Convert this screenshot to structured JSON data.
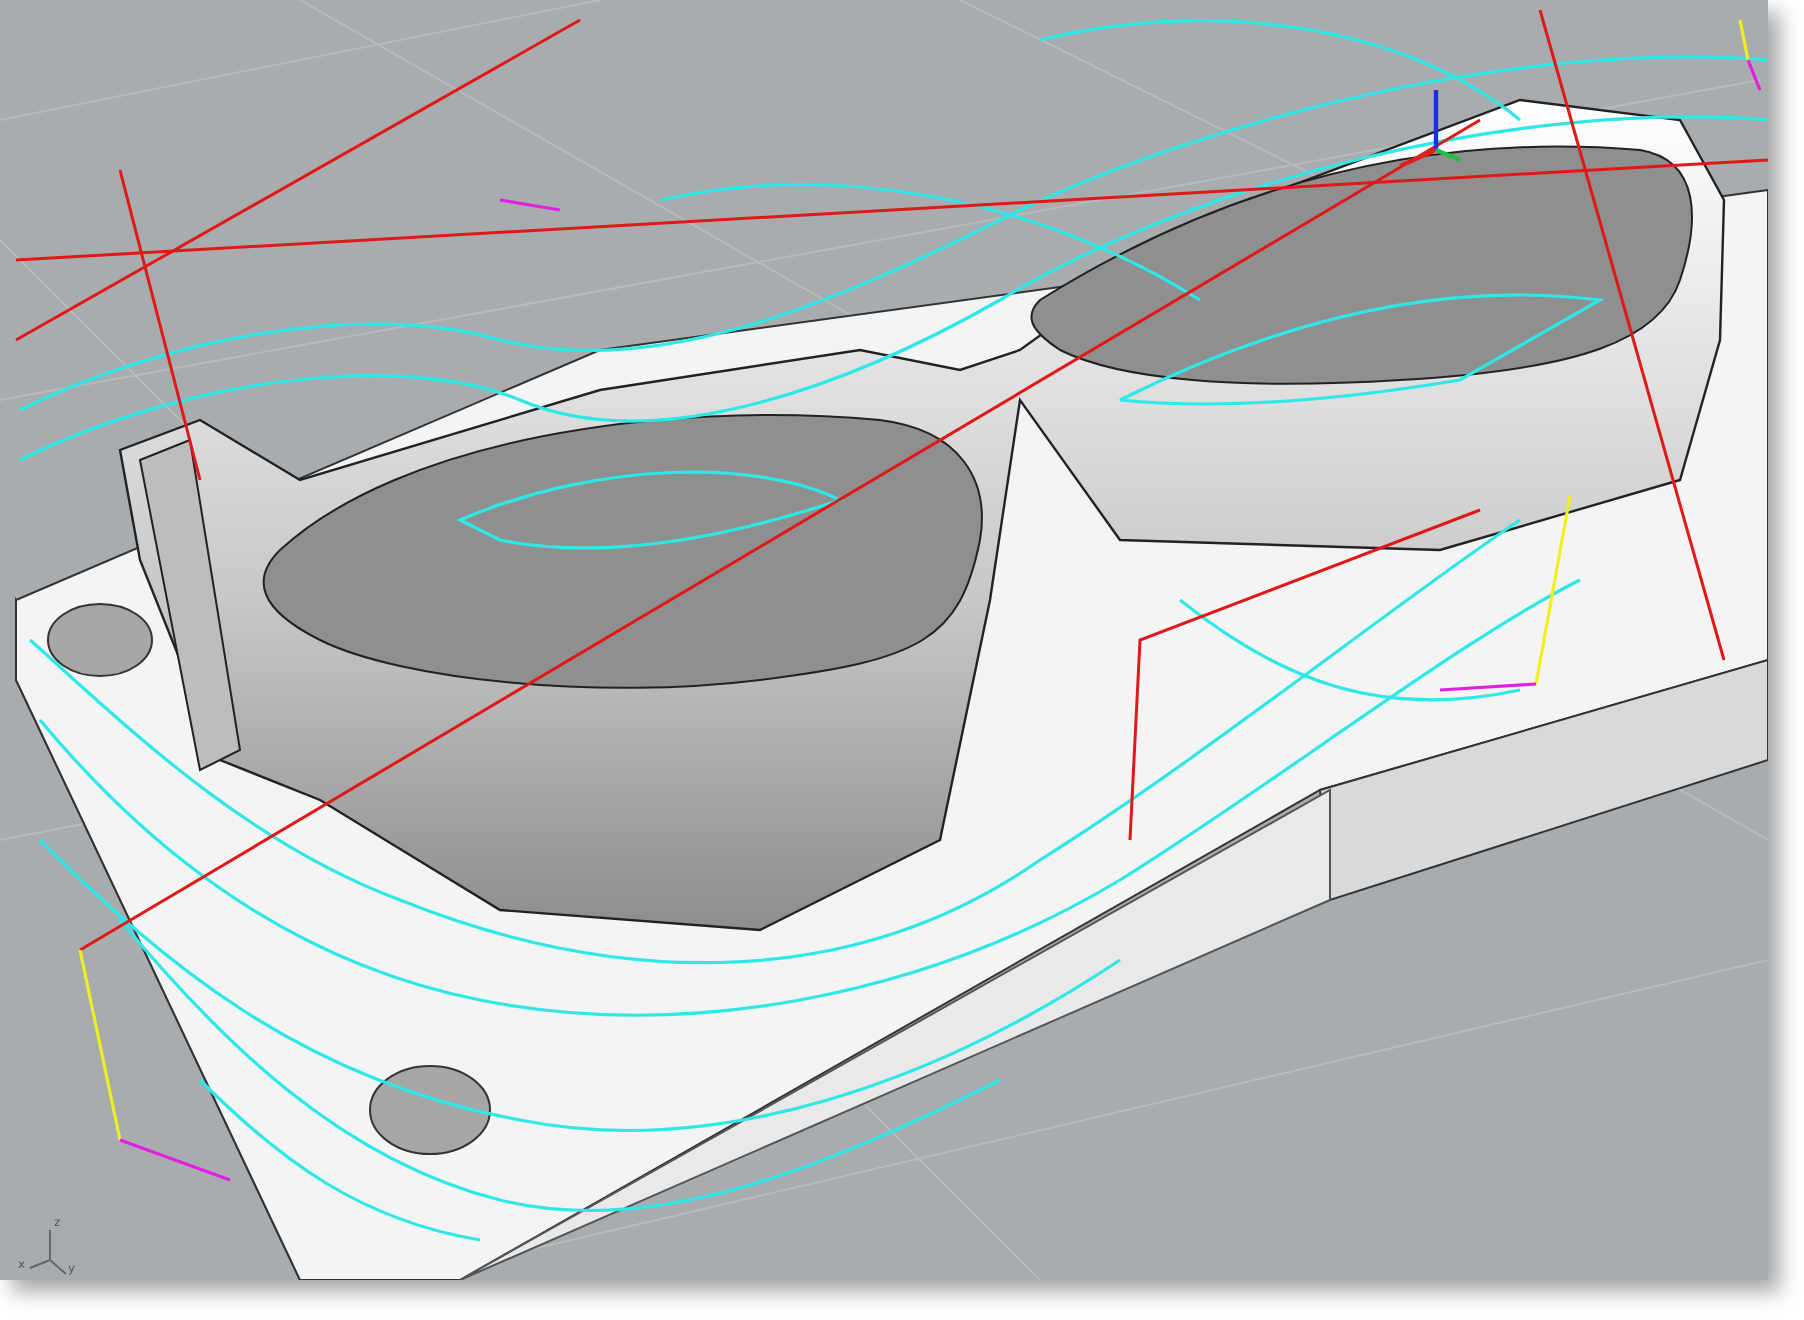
{
  "viewport": {
    "axis_labels": [
      "z",
      "x",
      "y"
    ]
  }
}
